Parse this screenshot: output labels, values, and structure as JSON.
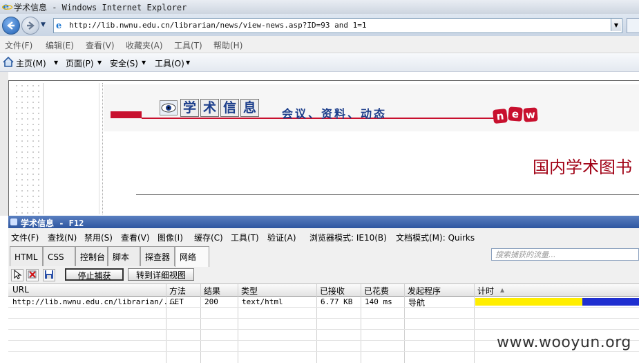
{
  "window": {
    "title": "学术信息 - Windows Internet Explorer"
  },
  "address": {
    "url": "http://lib.nwnu.edu.cn/librarian/news/view-news.asp?ID=93 and 1=1"
  },
  "menu": [
    "文件(F)",
    "编辑(E)",
    "查看(V)",
    "收藏夹(A)",
    "工具(T)",
    "帮助(H)"
  ],
  "commandbar": {
    "home": "主页(M)",
    "page": "页面(P)",
    "safety": "安全(S)",
    "tools": "工具(O)"
  },
  "page": {
    "header_chars": [
      "学",
      "术",
      "信",
      "息"
    ],
    "header_sub": "会议、资料、动态",
    "new_letters": [
      "n",
      "e",
      "w"
    ],
    "title": "国内学术图书"
  },
  "devtools": {
    "title": "学术信息 - F12",
    "menu": [
      "文件(F)",
      "查找(N)",
      "禁用(S)",
      "查看(V)",
      "图像(I)",
      "缓存(C)",
      "工具(T)",
      "验证(A)"
    ],
    "browser_mode": "浏览器模式: IE10(B)",
    "doc_mode": "文档模式(M): Quirks",
    "tabs": [
      "HTML",
      "CSS",
      "控制台",
      "脚本",
      "探查器",
      "网络"
    ],
    "search_placeholder": "搜索捕获的流量...",
    "stop_button": "停止捕获",
    "detail_button": "转到详细视图",
    "columns": [
      "URL",
      "方法",
      "结果",
      "类型",
      "已接收",
      "已花费",
      "发起程序",
      "计时"
    ],
    "sort_arrow": "▲",
    "rows": [
      {
        "url": "http://lib.nwnu.edu.cn/librarian/...",
        "method": "GET",
        "result": "200",
        "type": "text/html",
        "received": "6.77 KB",
        "taken": "140 ms",
        "initiator": "导航"
      }
    ]
  },
  "watermark": "www.wooyun.org",
  "colors": {
    "accent_red": "#c8102e",
    "title_red": "#a00014",
    "header_blue": "#1c3e8b",
    "timing_yellow": "#ffee00",
    "timing_blue": "#1f2fd0"
  }
}
